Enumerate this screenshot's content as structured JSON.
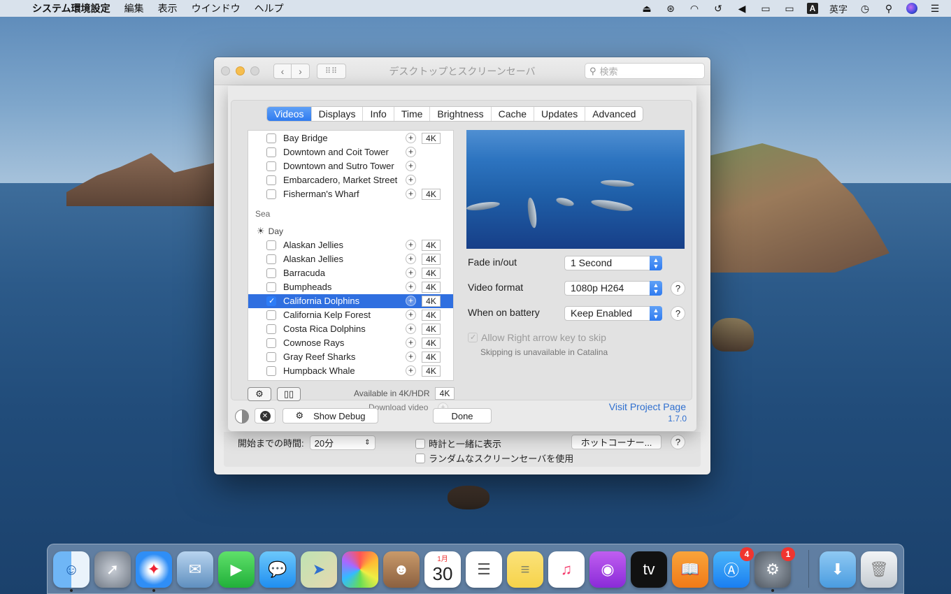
{
  "menubar": {
    "app": "システム環境設定",
    "items": [
      "編集",
      "表示",
      "ウインドウ",
      "ヘルプ"
    ],
    "input_source": "英字"
  },
  "window": {
    "title": "デスクトップとスクリーンセーバ",
    "search_placeholder": "検索"
  },
  "sheet": {
    "tabs": [
      "Videos",
      "Displays",
      "Info",
      "Time",
      "Brightness",
      "Cache",
      "Updates",
      "Advanced"
    ],
    "active_tab": "Videos",
    "top_rows": [
      {
        "label": "Bay Bridge",
        "k4": "4K"
      },
      {
        "label": "Downtown and Coit Tower",
        "k4": ""
      },
      {
        "label": "Downtown and Sutro Tower",
        "k4": ""
      },
      {
        "label": "Embarcadero, Market Street",
        "k4": ""
      },
      {
        "label": "Fisherman's Wharf",
        "k4": "4K"
      }
    ],
    "section": "Sea",
    "day_label": "Day",
    "sea_rows": [
      {
        "label": "Alaskan Jellies",
        "k4": "4K",
        "checked": false
      },
      {
        "label": "Alaskan Jellies",
        "k4": "4K",
        "checked": false
      },
      {
        "label": "Barracuda",
        "k4": "4K",
        "checked": false
      },
      {
        "label": "Bumpheads",
        "k4": "4K",
        "checked": false
      },
      {
        "label": "California Dolphins",
        "k4": "4K",
        "checked": true
      },
      {
        "label": "California Kelp Forest",
        "k4": "4K",
        "checked": false
      },
      {
        "label": "Costa Rica Dolphins",
        "k4": "4K",
        "checked": false
      },
      {
        "label": "Cownose Rays",
        "k4": "4K",
        "checked": false
      },
      {
        "label": "Gray Reef Sharks",
        "k4": "4K",
        "checked": false
      },
      {
        "label": "Humpback Whale",
        "k4": "4K",
        "checked": false
      }
    ],
    "available_label": "Available in 4K/HDR",
    "available_badge": "4K",
    "download_label": "Download video",
    "settings": {
      "fade_label": "Fade in/out",
      "fade_value": "1 Second",
      "format_label": "Video format",
      "format_value": "1080p H264",
      "battery_label": "When on battery",
      "battery_value": "Keep Enabled",
      "arrow_label": "Allow Right arrow key to skip",
      "arrow_note": "Skipping is unavailable in Catalina"
    },
    "visit_link": "Visit Project Page",
    "show_debug": "Show Debug",
    "done": "Done",
    "version": "1.7.0"
  },
  "window_bottom": {
    "start_label": "開始までの時間:",
    "start_value": "20分",
    "clock_label": "時計と一緒に表示",
    "random_label": "ランダムなスクリーンセーバを使用",
    "hotcorner_button": "ホットコーナー..."
  },
  "dock": {
    "calendar_month": "1月",
    "calendar_day": "30",
    "appstore_badge": "4",
    "sysprefs_badge": "1"
  }
}
